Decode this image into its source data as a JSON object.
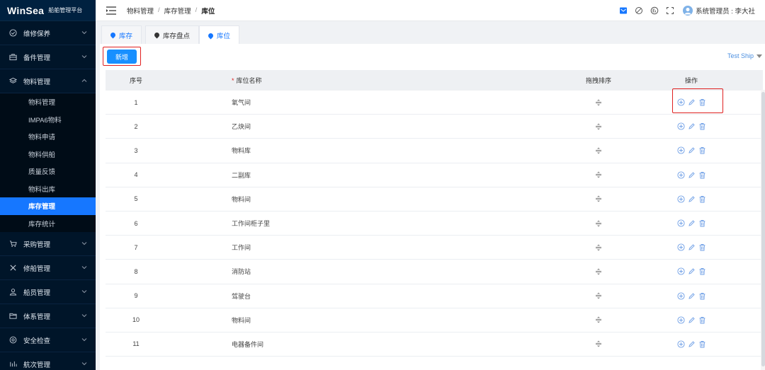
{
  "app": {
    "logo": "WinSea",
    "subtitle": "船舶管理平台"
  },
  "sidebar": {
    "items_top": [
      {
        "label": "维修保养",
        "icon": "check-circle-icon"
      },
      {
        "label": "备件管理",
        "icon": "briefcase-icon"
      },
      {
        "label": "物料管理",
        "icon": "layers-icon",
        "expanded": true
      }
    ],
    "subitems": [
      "物料管理",
      "IMPA6物料",
      "物料申请",
      "物料供船",
      "质量反馈",
      "物料出库",
      "库存管理",
      "库存统计"
    ],
    "active_subitem": "库存管理",
    "items_bottom": [
      {
        "label": "采购管理",
        "icon": "cart-icon"
      },
      {
        "label": "修船管理",
        "icon": "tools-icon"
      },
      {
        "label": "船员管理",
        "icon": "user-icon"
      },
      {
        "label": "体系管理",
        "icon": "folder-icon"
      },
      {
        "label": "安全检查",
        "icon": "target-icon"
      },
      {
        "label": "航次管理",
        "icon": "voyage-icon"
      }
    ]
  },
  "header": {
    "breadcrumb": [
      "物料管理",
      "库存管理",
      "库位"
    ],
    "user_label": "系统管理员 : 李大社"
  },
  "tabs": [
    {
      "label": "库存",
      "active": false
    },
    {
      "label": "库存盘点",
      "active": false
    },
    {
      "label": "库位",
      "active": true
    }
  ],
  "toolbar": {
    "add_label": "新增",
    "ship_select": "Test Ship"
  },
  "table": {
    "headers": {
      "index": "序号",
      "name": "库位名称",
      "required_mark": "*",
      "drag": "拖拽排序",
      "ops": "操作"
    },
    "rows": [
      {
        "index": "1",
        "name": "氧气间"
      },
      {
        "index": "2",
        "name": "乙炔间"
      },
      {
        "index": "3",
        "name": "物料库"
      },
      {
        "index": "4",
        "name": "二副库"
      },
      {
        "index": "5",
        "name": "物料间"
      },
      {
        "index": "6",
        "name": "工作间柜子里"
      },
      {
        "index": "7",
        "name": "工作间"
      },
      {
        "index": "8",
        "name": "消防站"
      },
      {
        "index": "9",
        "name": "驾驶台"
      },
      {
        "index": "10",
        "name": "物料间"
      },
      {
        "index": "11",
        "name": "电器备件间"
      }
    ]
  },
  "colors": {
    "accent": "#1677ff",
    "sidebar_bg": "#001529",
    "highlight": "#e02020"
  }
}
